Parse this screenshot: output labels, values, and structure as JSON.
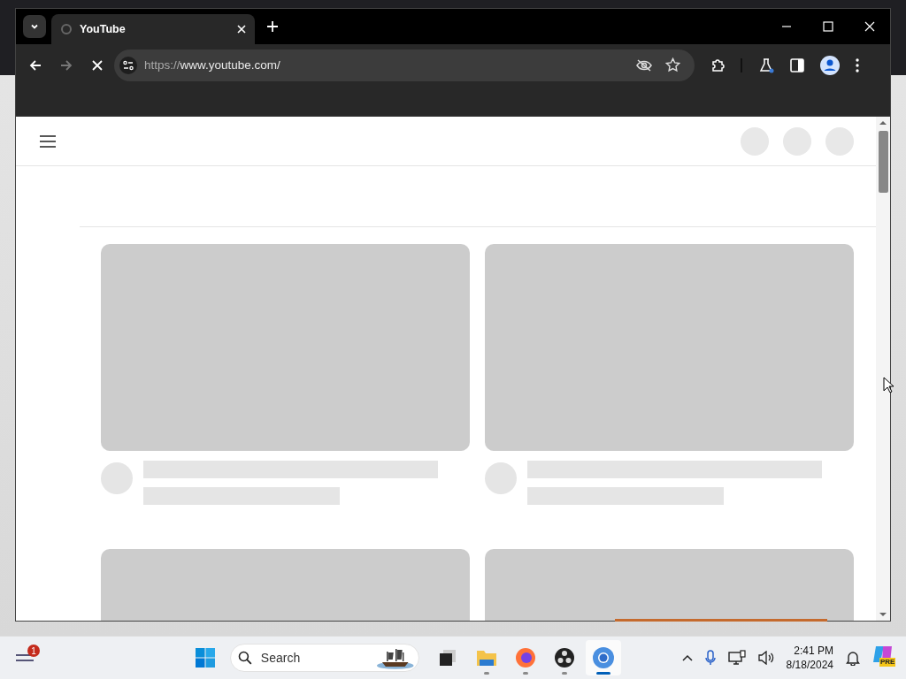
{
  "browser": {
    "tabs": [
      {
        "title": "YouTube",
        "selected": true
      }
    ],
    "loading": true,
    "address": {
      "scheme": "https://",
      "host": "www.youtube.com/"
    }
  },
  "page": {
    "cards": [
      {
        "kind": "full"
      },
      {
        "kind": "full"
      },
      {
        "kind": "partial"
      },
      {
        "kind": "partial"
      }
    ]
  },
  "taskbar": {
    "widgets_badge": "1",
    "search": {
      "label": "Search"
    },
    "apps": [
      {
        "kind": "files",
        "selected": false,
        "running": false
      },
      {
        "kind": "folder",
        "selected": false,
        "running": true
      },
      {
        "kind": "firefox",
        "selected": false,
        "running": true
      },
      {
        "kind": "obs",
        "selected": false,
        "running": true
      },
      {
        "kind": "chrome",
        "selected": true,
        "running": true
      }
    ],
    "time": "2:41 PM",
    "date": "8/18/2024",
    "copilot_badge": "PRE"
  }
}
